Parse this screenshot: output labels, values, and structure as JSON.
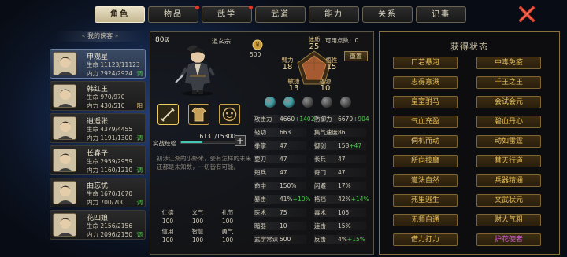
{
  "tabs": [
    {
      "label": "角色",
      "active": true,
      "dot": false
    },
    {
      "label": "物品",
      "active": false,
      "dot": true
    },
    {
      "label": "武学",
      "active": false,
      "dot": true
    },
    {
      "label": "武道",
      "active": false,
      "dot": false
    },
    {
      "label": "能力",
      "active": false,
      "dot": false
    },
    {
      "label": "关系",
      "active": false,
      "dot": false
    },
    {
      "label": "记事",
      "active": false,
      "dot": false
    }
  ],
  "roster": {
    "header": "我的侠客",
    "characters": [
      {
        "name": "申观星",
        "hp": "生命 11123/11123",
        "mp": "内力 2924/2924",
        "tag": "调",
        "tag_color": "green",
        "selected": true
      },
      {
        "name": "韩红玉",
        "hp": "生命 970/970",
        "mp": "内力 430/510",
        "tag": "阳",
        "tag_color": "gold",
        "selected": false
      },
      {
        "name": "逍遥张",
        "hp": "生命 4379/4455",
        "mp": "内力 1191/1300",
        "tag": "调",
        "tag_color": "green",
        "selected": false
      },
      {
        "name": "长春子",
        "hp": "生命 2959/2959",
        "mp": "内力 1160/1210",
        "tag": "调",
        "tag_color": "green",
        "selected": false
      },
      {
        "name": "曲忘忧",
        "hp": "生命 1670/1670",
        "mp": "内力 700/700",
        "tag": "调",
        "tag_color": "green",
        "selected": false
      },
      {
        "name": "花四娘",
        "hp": "生命 2156/2156",
        "mp": "内力 2096/2150",
        "tag": "调",
        "tag_color": "green",
        "selected": false
      }
    ]
  },
  "detail": {
    "level_num": "80",
    "level_unit": "级",
    "sect": "道玄宗",
    "coin_value": "500",
    "points_label": "可用点数：",
    "points_value": "0",
    "reset_label": "重置",
    "attributes": {
      "tizhi": {
        "label": "体质",
        "value": "25"
      },
      "bili": {
        "label": "臂力",
        "value": "18"
      },
      "wuxing": {
        "label": "悟性",
        "value": "15"
      },
      "minjie": {
        "label": "敏捷",
        "value": "13"
      },
      "fuku": {
        "label": "福源",
        "value": "10"
      }
    },
    "gems": [
      {
        "color": "#3fa0a6"
      },
      {
        "color": "#3fa0a6"
      },
      {
        "color": "#555555"
      },
      {
        "color": "#555555"
      },
      {
        "color": "#555555"
      }
    ],
    "exp_label": "实战经验",
    "exp_value": "6131/15300",
    "exp_fraction": 0.4,
    "description": "初涉江湖的小虾米，会有怎样的未来还都是未知数，一切皆有可能。",
    "virtues": [
      {
        "label": "仁德",
        "value": "100"
      },
      {
        "label": "义气",
        "value": "100"
      },
      {
        "label": "礼节",
        "value": "100"
      },
      {
        "label": "信用",
        "value": "100"
      },
      {
        "label": "智慧",
        "value": "100"
      },
      {
        "label": "勇气",
        "value": "100"
      }
    ]
  },
  "stats_left": [
    {
      "label": "攻击力",
      "value": "4660",
      "bonus": "+1402"
    },
    {
      "label": "轻功",
      "value": "663",
      "bonus": ""
    },
    {
      "label": "拳掌",
      "value": "47",
      "bonus": ""
    },
    {
      "label": "耍刀",
      "value": "47",
      "bonus": ""
    },
    {
      "label": "短兵",
      "value": "47",
      "bonus": ""
    },
    {
      "label": "命中",
      "value": "150%",
      "bonus": ""
    },
    {
      "label": "暴击",
      "value": "41%",
      "bonus": "+10%"
    },
    {
      "label": "医术",
      "value": "75",
      "bonus": ""
    },
    {
      "label": "暗器",
      "value": "10",
      "bonus": ""
    },
    {
      "label": "武学常识",
      "value": "500",
      "bonus": ""
    }
  ],
  "stats_right": [
    {
      "label": "防御力",
      "value": "6670",
      "bonus": "+904"
    },
    {
      "label": "集气速度",
      "value": "86",
      "bonus": ""
    },
    {
      "label": "御剑",
      "value": "158",
      "bonus": "+47"
    },
    {
      "label": "长兵",
      "value": "47",
      "bonus": ""
    },
    {
      "label": "奇门",
      "value": "47",
      "bonus": ""
    },
    {
      "label": "闪避",
      "value": "17%",
      "bonus": ""
    },
    {
      "label": "格挡",
      "value": "42%",
      "bonus": "+14%"
    },
    {
      "label": "毒术",
      "value": "105",
      "bonus": ""
    },
    {
      "label": "连击",
      "value": "15%",
      "bonus": ""
    },
    {
      "label": "反击",
      "value": "4%",
      "bonus": "+15%"
    }
  ],
  "status_panel": {
    "title": "获得状态",
    "buffs": [
      {
        "label": "口若悬河",
        "color": "gold"
      },
      {
        "label": "中毒免疫",
        "color": "gold"
      },
      {
        "label": "志得意满",
        "color": "gold"
      },
      {
        "label": "千王之王",
        "color": "gold"
      },
      {
        "label": "皇室驸马",
        "color": "gold"
      },
      {
        "label": "会试会元",
        "color": "gold"
      },
      {
        "label": "气血充盈",
        "color": "gold"
      },
      {
        "label": "碧血丹心",
        "color": "gold"
      },
      {
        "label": "伺机而动",
        "color": "gold"
      },
      {
        "label": "动如雷霆",
        "color": "gold"
      },
      {
        "label": "所向披靡",
        "color": "gold"
      },
      {
        "label": "替天行道",
        "color": "gold"
      },
      {
        "label": "道法自然",
        "color": "gold"
      },
      {
        "label": "兵器精通",
        "color": "gold"
      },
      {
        "label": "死里逃生",
        "color": "gold"
      },
      {
        "label": "文武状元",
        "color": "gold"
      },
      {
        "label": "无师自通",
        "color": "gold"
      },
      {
        "label": "财大气粗",
        "color": "gold"
      },
      {
        "label": "借力打力",
        "color": "gold"
      },
      {
        "label": "护花使者",
        "color": "purple"
      }
    ]
  }
}
